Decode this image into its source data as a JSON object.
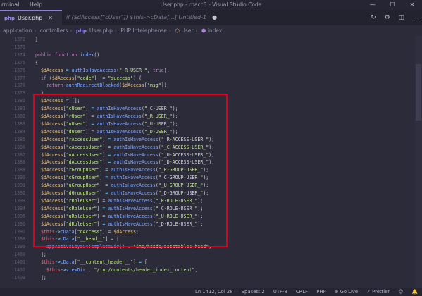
{
  "titlebar": {
    "menu": [
      "rminal",
      "Help"
    ],
    "title": "User.php - rbacc3 - Visual Studio Code",
    "controls": {
      "minimize": "—",
      "maximize": "☐",
      "close": "✕"
    }
  },
  "tabs": [
    {
      "label": "User.php",
      "close": "✕",
      "active": true
    },
    {
      "label": "if ($dAccess[\"cUser\"]) $this->cData[...]  Untitled-1",
      "close": "●",
      "active": false
    }
  ],
  "tab_actions": [
    "↻",
    "⚙",
    "◫",
    "…"
  ],
  "breadcrumb": [
    "application",
    "controllers",
    "User.php",
    "PHP Intelephense",
    "User",
    "index"
  ],
  "code_lines": [
    {
      "ln": "1372",
      "html": "<span class=\"tok-punc\">}</span>"
    },
    {
      "ln": "1373",
      "html": ""
    },
    {
      "ln": "1374",
      "html": "<span class=\"tok-kw\">public function</span> <span class=\"tok-fn\">index</span><span class=\"tok-punc\">()</span>"
    },
    {
      "ln": "1375",
      "html": "<span class=\"tok-punc\">{</span>"
    },
    {
      "ln": "1376",
      "html": "  <span class=\"tok-var\">$dAccess</span> <span class=\"tok-op\">=</span> <span class=\"tok-fn\">authIsHaveAccess</span><span class=\"tok-punc\">(</span><span class=\"tok-str\">\"_R-USER_\"</span><span class=\"tok-punc\">, </span><span class=\"tok-kw\">true</span><span class=\"tok-punc\">);</span>"
    },
    {
      "ln": "1377",
      "html": "  <span class=\"tok-kw\">if</span> <span class=\"tok-punc\">(</span><span class=\"tok-var\">$dAccess</span><span class=\"tok-punc\">[</span><span class=\"tok-str\">\"code\"</span><span class=\"tok-punc\">]</span> <span class=\"tok-op\">!=</span> <span class=\"tok-str\">\"success\"</span><span class=\"tok-punc\">) {</span>"
    },
    {
      "ln": "1378",
      "html": "    <span class=\"tok-kw\">return</span> <span class=\"tok-fn\">authRedirectBlocked</span><span class=\"tok-punc\">(</span><span class=\"tok-var\">$dAccess</span><span class=\"tok-punc\">[</span><span class=\"tok-str\">\"msg\"</span><span class=\"tok-punc\">]);</span>"
    },
    {
      "ln": "1379",
      "html": "  <span class=\"tok-punc\">}</span>"
    },
    {
      "ln": "1380",
      "html": "  <span class=\"tok-var\">$dAccess</span> <span class=\"tok-op\">=</span> <span class=\"tok-punc\">[];</span>"
    },
    {
      "ln": "1381",
      "html": "  <span class=\"tok-var\">$dAccess</span><span class=\"tok-punc\">[</span><span class=\"tok-str\">\"cUser\"</span><span class=\"tok-punc\">]</span> <span class=\"tok-op\">=</span> <span class=\"tok-fn\">authIsHaveAccess</span><span class=\"tok-punc\">(</span><span class=\"tok-str\">\"_C-USER_\"</span><span class=\"tok-punc\">);</span>"
    },
    {
      "ln": "1382",
      "html": "  <span class=\"tok-var\">$dAccess</span><span class=\"tok-punc\">[</span><span class=\"tok-str\">\"rUser\"</span><span class=\"tok-punc\">]</span> <span class=\"tok-op\">=</span> <span class=\"tok-fn\">authIsHaveAccess</span><span class=\"tok-punc\">(</span><span class=\"tok-str\">\"_R-USER_\"</span><span class=\"tok-punc\">);</span>"
    },
    {
      "ln": "1383",
      "html": "  <span class=\"tok-var\">$dAccess</span><span class=\"tok-punc\">[</span><span class=\"tok-str\">\"uUser\"</span><span class=\"tok-punc\">]</span> <span class=\"tok-op\">=</span> <span class=\"tok-fn\">authIsHaveAccess</span><span class=\"tok-punc\">(</span><span class=\"tok-str\">\"_U-USER_\"</span><span class=\"tok-punc\">);</span>"
    },
    {
      "ln": "1384",
      "html": "  <span class=\"tok-var\">$dAccess</span><span class=\"tok-punc\">[</span><span class=\"tok-str\">\"dUser\"</span><span class=\"tok-punc\">]</span> <span class=\"tok-op\">=</span> <span class=\"tok-fn\">authIsHaveAccess</span><span class=\"tok-punc\">(</span><span class=\"tok-str\">\"_D-USER_\"</span><span class=\"tok-punc\">);</span>"
    },
    {
      "ln": "1385",
      "html": "  <span class=\"tok-var\">$dAccess</span><span class=\"tok-punc\">[</span><span class=\"tok-str\">\"rAccessUser\"</span><span class=\"tok-punc\">]</span> <span class=\"tok-op\">=</span> <span class=\"tok-fn\">authIsHaveAccess</span><span class=\"tok-punc\">(</span><span class=\"tok-str\">\"_R-ACCESS-USER_\"</span><span class=\"tok-punc\">);</span>"
    },
    {
      "ln": "1386",
      "html": "  <span class=\"tok-var\">$dAccess</span><span class=\"tok-punc\">[</span><span class=\"tok-str\">\"cAccessUser\"</span><span class=\"tok-punc\">]</span> <span class=\"tok-op\">=</span> <span class=\"tok-fn\">authIsHaveAccess</span><span class=\"tok-punc\">(</span><span class=\"tok-str\">\"_C-ACCESS-USER_\"</span><span class=\"tok-punc\">);</span>"
    },
    {
      "ln": "1387",
      "html": "  <span class=\"tok-var\">$dAccess</span><span class=\"tok-punc\">[</span><span class=\"tok-str\">\"uAccessUser\"</span><span class=\"tok-punc\">]</span> <span class=\"tok-op\">=</span> <span class=\"tok-fn\">authIsHaveAccess</span><span class=\"tok-punc\">(</span><span class=\"tok-str\">\"_U-ACCESS-USER_\"</span><span class=\"tok-punc\">);</span>"
    },
    {
      "ln": "1388",
      "html": "  <span class=\"tok-var\">$dAccess</span><span class=\"tok-punc\">[</span><span class=\"tok-str\">\"dAccessUser\"</span><span class=\"tok-punc\">]</span> <span class=\"tok-op\">=</span> <span class=\"tok-fn\">authIsHaveAccess</span><span class=\"tok-punc\">(</span><span class=\"tok-str\">\"_D-ACCESS-USER_\"</span><span class=\"tok-punc\">);</span>"
    },
    {
      "ln": "1389",
      "html": "  <span class=\"tok-var\">$dAccess</span><span class=\"tok-punc\">[</span><span class=\"tok-str\">\"rGroupUser\"</span><span class=\"tok-punc\">]</span> <span class=\"tok-op\">=</span> <span class=\"tok-fn\">authIsHaveAccess</span><span class=\"tok-punc\">(</span><span class=\"tok-str\">\"_R-GROUP-USER_\"</span><span class=\"tok-punc\">);</span>"
    },
    {
      "ln": "1390",
      "html": "  <span class=\"tok-var\">$dAccess</span><span class=\"tok-punc\">[</span><span class=\"tok-str\">\"cGroupUser\"</span><span class=\"tok-punc\">]</span> <span class=\"tok-op\">=</span> <span class=\"tok-fn\">authIsHaveAccess</span><span class=\"tok-punc\">(</span><span class=\"tok-str\">\"_C-GROUP-USER_\"</span><span class=\"tok-punc\">);</span>"
    },
    {
      "ln": "1391",
      "html": "  <span class=\"tok-var\">$dAccess</span><span class=\"tok-punc\">[</span><span class=\"tok-str\">\"uGroupUser\"</span><span class=\"tok-punc\">]</span> <span class=\"tok-op\">=</span> <span class=\"tok-fn\">authIsHaveAccess</span><span class=\"tok-punc\">(</span><span class=\"tok-str\">\"_U-GROUP-USER_\"</span><span class=\"tok-punc\">);</span>"
    },
    {
      "ln": "1392",
      "html": "  <span class=\"tok-var\">$dAccess</span><span class=\"tok-punc\">[</span><span class=\"tok-str\">\"dGroupUser\"</span><span class=\"tok-punc\">]</span> <span class=\"tok-op\">=</span> <span class=\"tok-fn\">authIsHaveAccess</span><span class=\"tok-punc\">(</span><span class=\"tok-str\">\"_D-GROUP-USER_\"</span><span class=\"tok-punc\">);</span>"
    },
    {
      "ln": "1393",
      "html": "  <span class=\"tok-var\">$dAccess</span><span class=\"tok-punc\">[</span><span class=\"tok-str\">\"rRoleUser\"</span><span class=\"tok-punc\">]</span> <span class=\"tok-op\">=</span> <span class=\"tok-fn\">authIsHaveAccess</span><span class=\"tok-punc\">(</span><span class=\"tok-str\">\"_R-ROLE-USER_\"</span><span class=\"tok-punc\">);</span>"
    },
    {
      "ln": "1394",
      "html": "  <span class=\"tok-var\">$dAccess</span><span class=\"tok-punc\">[</span><span class=\"tok-str\">\"cRoleUser\"</span><span class=\"tok-punc\">]</span> <span class=\"tok-op\">=</span> <span class=\"tok-fn\">authIsHaveAccess</span><span class=\"tok-punc\">(</span><span class=\"tok-str\">\"_C-ROLE-USER_\"</span><span class=\"tok-punc\">);</span>"
    },
    {
      "ln": "1395",
      "html": "  <span class=\"tok-var\">$dAccess</span><span class=\"tok-punc\">[</span><span class=\"tok-str\">\"uRoleUser\"</span><span class=\"tok-punc\">]</span> <span class=\"tok-op\">=</span> <span class=\"tok-fn\">authIsHaveAccess</span><span class=\"tok-punc\">(</span><span class=\"tok-str\">\"_U-ROLE-USER_\"</span><span class=\"tok-punc\">);</span>"
    },
    {
      "ln": "1396",
      "html": "  <span class=\"tok-var\">$dAccess</span><span class=\"tok-punc\">[</span><span class=\"tok-str\">\"dRoleUser\"</span><span class=\"tok-punc\">]</span> <span class=\"tok-op\">=</span> <span class=\"tok-fn\">authIsHaveAccess</span><span class=\"tok-punc\">(</span><span class=\"tok-str\">\"_D-ROLE-USER_\"</span><span class=\"tok-punc\">);</span>"
    },
    {
      "ln": "1397",
      "html": "  <span class=\"tok-this\">$this</span><span class=\"tok-op\">-&gt;</span><span class=\"tok-fn\">cData</span><span class=\"tok-punc\">[</span><span class=\"tok-str\">\"dAccess\"</span><span class=\"tok-punc\">]</span> <span class=\"tok-op\">=</span> <span class=\"tok-var\">$dAccess</span><span class=\"tok-punc\">;</span>"
    },
    {
      "ln": "1398",
      "html": "  <span class=\"tok-this\">$this</span><span class=\"tok-op\">-&gt;</span><span class=\"tok-fn\">cData</span><span class=\"tok-punc\">[</span><span class=\"tok-str\">\"__head__\"</span><span class=\"tok-punc\">]</span> <span class=\"tok-op\">=</span> <span class=\"tok-punc\">[</span>"
    },
    {
      "ln": "1399",
      "html": "    <span class=\"tok-fn\">appActiveLayoutTemplateDir</span><span class=\"tok-punc\">()</span> <span class=\"tok-op\">.</span> <span class=\"tok-str\">\"inc/heads/datatables_head\"</span><span class=\"tok-punc\">,</span>"
    },
    {
      "ln": "1400",
      "html": "  <span class=\"tok-punc\">];</span>"
    },
    {
      "ln": "1401",
      "html": "  <span class=\"tok-this\">$this</span><span class=\"tok-op\">-&gt;</span><span class=\"tok-fn\">cData</span><span class=\"tok-punc\">[</span><span class=\"tok-str\">\"__content_header__\"</span><span class=\"tok-punc\">]</span> <span class=\"tok-op\">=</span> <span class=\"tok-punc\">[</span>"
    },
    {
      "ln": "1402",
      "html": "    <span class=\"tok-this\">$this</span><span class=\"tok-op\">-&gt;</span><span class=\"tok-fn\">viewDir</span> <span class=\"tok-op\">.</span> <span class=\"tok-str\">\"/inc/contents/header_index_content\"</span><span class=\"tok-punc\">,</span>"
    },
    {
      "ln": "1403",
      "html": "  <span class=\"tok-punc\">];</span>"
    }
  ],
  "statusbar": {
    "position": "Ln 1412, Col 28",
    "spaces": "Spaces: 2",
    "encoding": "UTF-8",
    "eol": "CRLF",
    "language": "PHP",
    "golive": "⊕ Go Live",
    "prettier": "✓ Prettier",
    "feedback": "☺",
    "bell": "🔔"
  }
}
